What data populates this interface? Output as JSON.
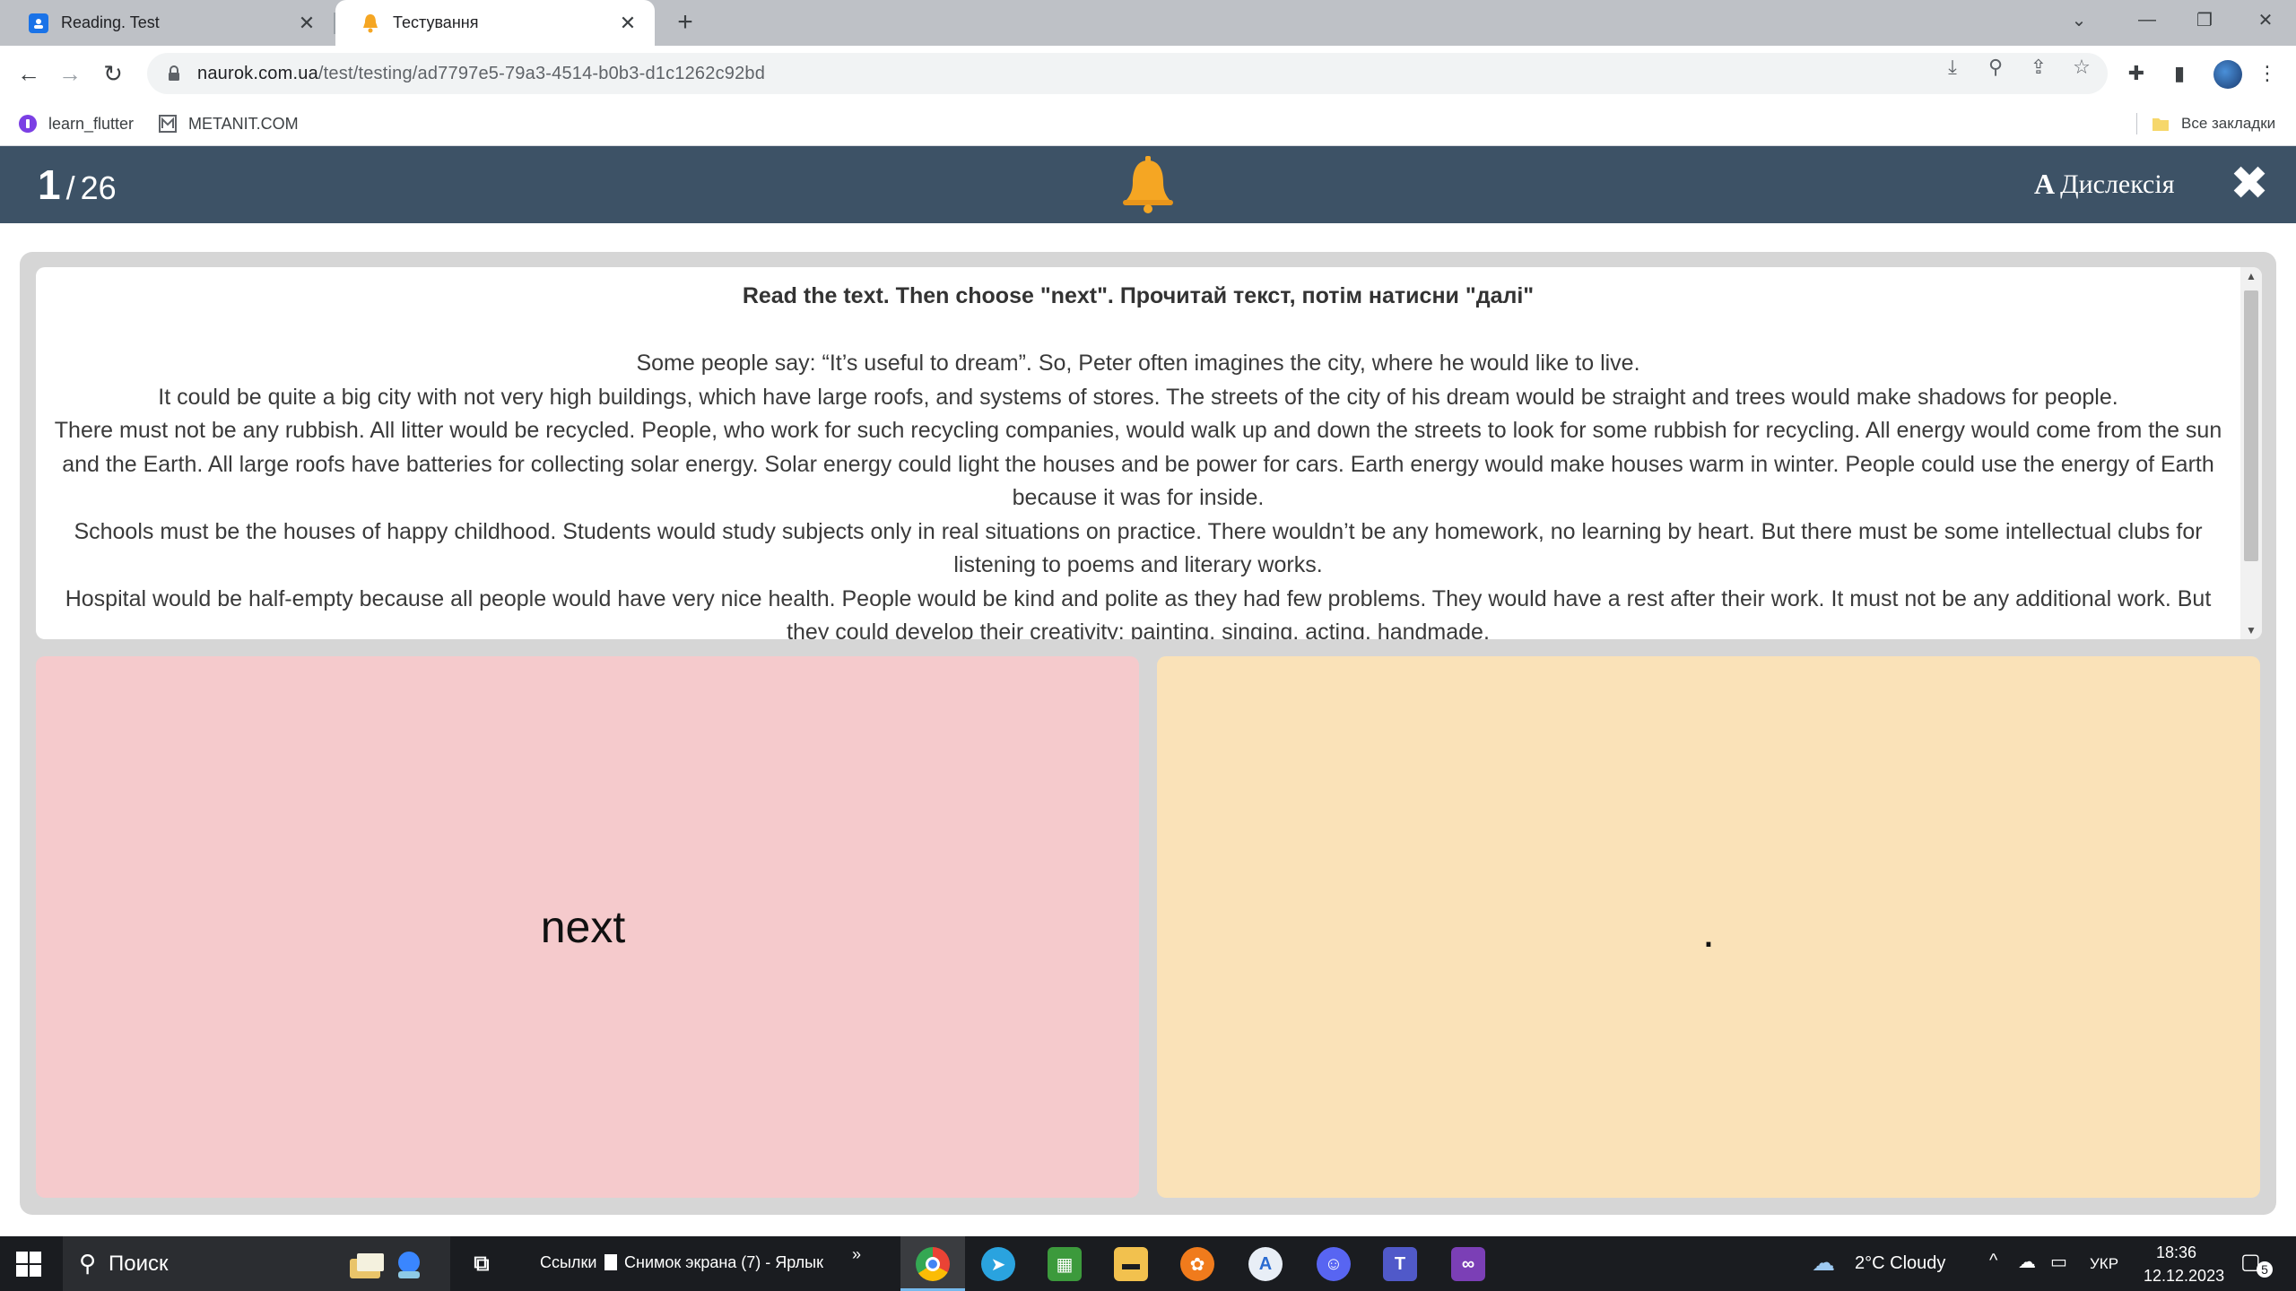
{
  "browser": {
    "tabs": [
      {
        "title": "Reading. Test",
        "close": "✕",
        "active": false
      },
      {
        "title": "Тестування",
        "close": "✕",
        "active": true
      }
    ],
    "new_tab": "+",
    "url_host": "naurok.com.ua",
    "url_path": "/test/testing/ad7797e5-79a3-4514-b0b3-d1c1262c92bd",
    "bookmarks": [
      {
        "label": "learn_flutter"
      },
      {
        "label": "METANIT.COM"
      }
    ],
    "all_bookmarks": "Все закладки"
  },
  "test": {
    "current": "1",
    "separator": "/",
    "total": "26",
    "dyslexia_icon": "A",
    "dyslexia_label": "Дислексія",
    "close": "✖",
    "question_heading": "Read the text. Then choose \"next\". Прочитай текст, потім натисни \"далі\"",
    "paragraphs": [
      "Some people say: “It’s useful to dream”. So, Peter often imagines the city, where he would like to live.",
      "It could be quite a big city with not very high buildings, which have large roofs, and systems of stores. The streets of the city of his dream would be straight and trees would make shadows for people.",
      "There must not be any rubbish. All litter would be recycled. People, who work for such recycling companies, would walk up and down the streets to look for some rubbish for recycling. All energy would come from the sun and the Earth. All large roofs have batteries for collecting solar energy. Solar energy could light the houses and be power for cars. Earth energy would make houses warm in winter. People could use the energy of Earth because it was for inside.",
      "Schools must be the houses of happy childhood. Students would study subjects only in real situations on practice. There wouldn’t be any homework, no learning by heart. But there must be some intellectual clubs for listening to poems and literary works.",
      "Hospital would be half-empty because all people would have very nice health. People would be kind and polite as they had few problems. They would have a rest after their work. It must not be any additional work. But they could develop their creativity: painting, singing, acting, handmade."
    ],
    "answers": [
      {
        "label": "next",
        "color": "#f5cacc"
      },
      {
        "label": ".",
        "color": "#fae2b8"
      }
    ]
  },
  "taskbar": {
    "search_placeholder": "Поиск",
    "links_label": "Ссылки",
    "shortcut_label": "Снимок экрана (7) - Ярлык",
    "more": "»",
    "weather": "2°C  Cloudy",
    "language": "УКР",
    "time": "18:36",
    "date": "12.12.2023",
    "notifications": "5"
  },
  "colors": {
    "header_bg": "#3d5266",
    "bell": "#f5a623",
    "answer_a": "#f5cacc",
    "answer_b": "#fae2b8"
  }
}
